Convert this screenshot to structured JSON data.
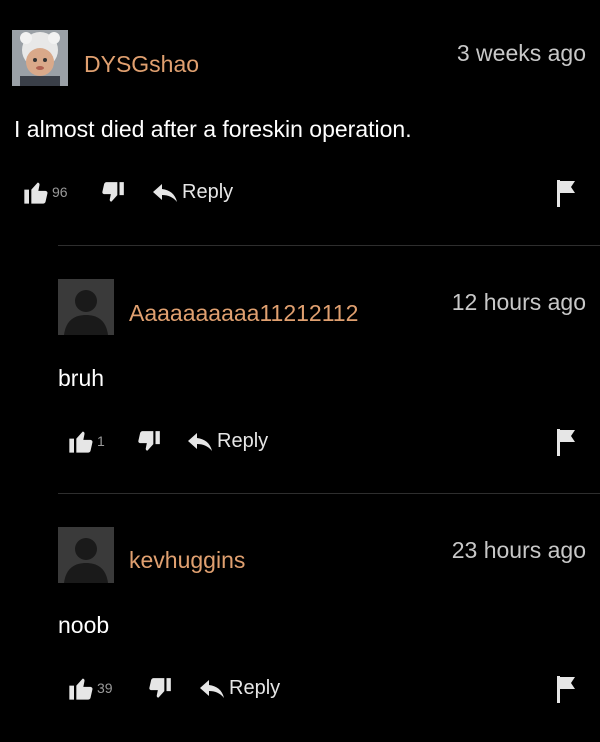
{
  "comments": [
    {
      "username": "DYSGshao",
      "timestamp": "3 weeks ago",
      "text": "I almost died after a foreskin operation.",
      "likes": "96",
      "reply_label": "Reply",
      "avatar": "photo-avatar"
    },
    {
      "username": "Aaaaaaaaaa11212112",
      "timestamp": "12 hours ago",
      "text": "bruh",
      "likes": "1",
      "reply_label": "Reply",
      "avatar": "default-silhouette-avatar"
    },
    {
      "username": "kevhuggins",
      "timestamp": "23 hours ago",
      "text": "noob",
      "likes": "39",
      "reply_label": "Reply",
      "avatar": "default-silhouette-avatar"
    }
  ],
  "colors": {
    "background": "#000000",
    "username": "#e0a070",
    "timestamp": "#c8c8c8",
    "count": "#9a9a9a",
    "divider": "#2e2e2e"
  }
}
